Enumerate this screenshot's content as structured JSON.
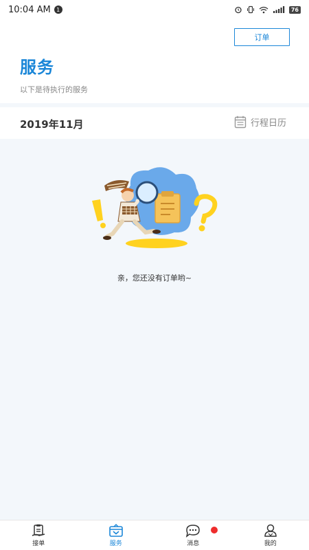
{
  "status_bar": {
    "time": "10:04 AM",
    "notification_count": "1",
    "battery": "76"
  },
  "header": {
    "order_button_label": "订单",
    "title": "服务",
    "subtitle": "以下是待执行的服务"
  },
  "month_bar": {
    "month": "2019年11月",
    "calendar_label": "行程日历"
  },
  "empty_state": {
    "message": "亲，您还没有订单哟~"
  },
  "tab_bar": {
    "tabs": [
      {
        "label": "接单",
        "icon": "clipboard-hand-icon"
      },
      {
        "label": "服务",
        "icon": "service-box-icon"
      },
      {
        "label": "消息",
        "icon": "chat-bubble-icon"
      },
      {
        "label": "我的",
        "icon": "user-icon"
      }
    ],
    "active_index": 1,
    "active_color": "#1a86d8"
  },
  "colors": {
    "accent": "#1a86d8",
    "background": "#f3f7fb",
    "badge": "#ee2d2d"
  }
}
